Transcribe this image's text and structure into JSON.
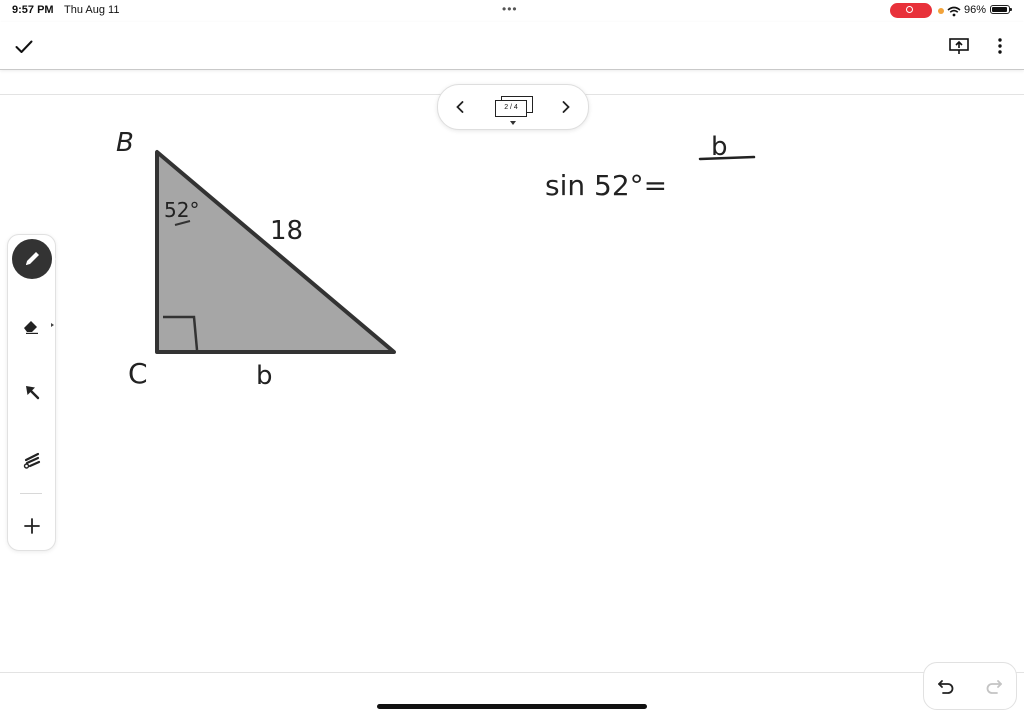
{
  "status_bar": {
    "time": "9:57 PM",
    "date": "Thu Aug 11",
    "battery_percent": "96%",
    "icons": [
      "multitasking-dots-icon",
      "screen-recording-icon",
      "wifi-icon",
      "battery-icon"
    ],
    "recording_color": "#e8313a"
  },
  "toolbar": {
    "icons": [
      "checkmark-icon",
      "present-icon",
      "more-options-icon"
    ]
  },
  "pager": {
    "page_indicator": "2 / 4",
    "icons": [
      "chevron-left-icon",
      "chevron-right-icon",
      "page-thumbnail-icon"
    ]
  },
  "tools": {
    "items": [
      "pen",
      "eraser",
      "select",
      "laser-pointer",
      "add"
    ],
    "active": "pen",
    "active_color": "#333333"
  },
  "canvas": {
    "vertex_b": "B",
    "vertex_c": "C",
    "angle_label": "52°",
    "hypotenuse_label": "18",
    "side_label": "b",
    "equation_left": "sin 52°=",
    "equation_numerator": "b",
    "triangle_fill": "#a6a6a6"
  },
  "undo_redo": {
    "icons": [
      "undo-icon",
      "redo-icon"
    ],
    "redo_enabled": false
  }
}
